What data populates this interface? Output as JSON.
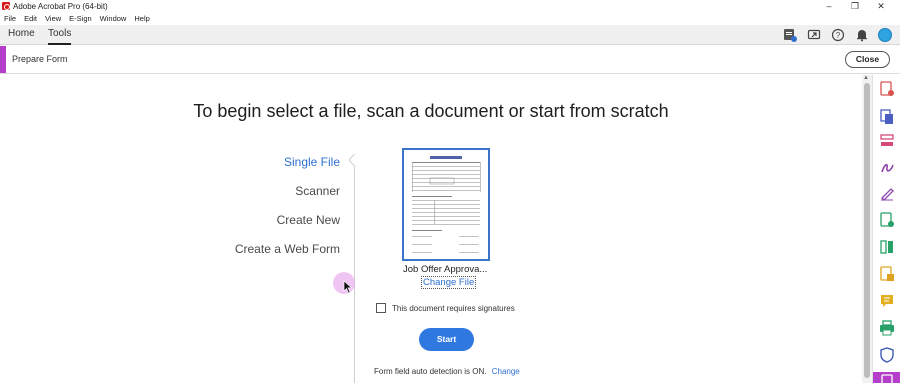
{
  "app": {
    "title": "Adobe Acrobat Pro (64-bit)",
    "window_controls": [
      "–",
      "❐",
      "✕"
    ]
  },
  "menu": [
    "File",
    "Edit",
    "View",
    "E-Sign",
    "Window",
    "Help"
  ],
  "tabs": {
    "home": "Home",
    "tools": "Tools"
  },
  "toolbar_icons": [
    "create-pdf-icon",
    "share-icon",
    "help-icon",
    "bell-icon",
    "account-avatar"
  ],
  "tool": {
    "name": "Prepare Form",
    "close_label": "Close",
    "accent_color": "#b43ec9"
  },
  "main": {
    "heading": "To begin select a file, scan a document or start from scratch",
    "nav": [
      {
        "label": "Single File",
        "active": true
      },
      {
        "label": "Scanner",
        "active": false
      },
      {
        "label": "Create New",
        "active": false
      },
      {
        "label": "Create a Web Form",
        "active": false
      }
    ],
    "file": {
      "name": "Job Offer Approva...",
      "change_label": "Change File"
    },
    "signature_label": "This document requires signatures",
    "start_label": "Start",
    "autodetect_text": "Form field auto detection is ON.",
    "autodetect_link": "Change"
  },
  "rail_icons": [
    "export-pdf-icon",
    "combine-files-icon",
    "organize-pages-icon",
    "request-signatures-icon",
    "fill-sign-icon",
    "create-pdf-icon",
    "compare-files-icon",
    "edit-pdf-icon",
    "comment-icon",
    "print-production-icon",
    "protect-icon",
    "prepare-form-icon"
  ],
  "colors": {
    "link_blue": "#2d6fcf",
    "primary_button": "#2f78e0",
    "thumb_border": "#3b73c8"
  }
}
